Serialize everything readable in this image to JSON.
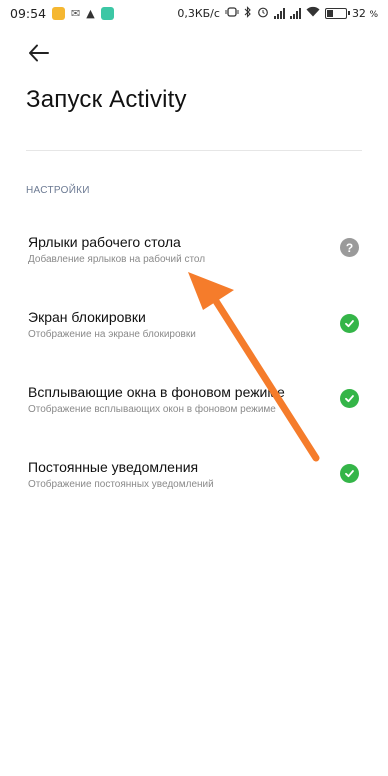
{
  "status_bar": {
    "time": "09:54",
    "network_speed": "0,3КБ/с",
    "battery_percent": "32",
    "battery_unit": "%",
    "battery_level": 0.32,
    "icons": [
      "notification-icon",
      "mail-icon",
      "app-icon",
      "shield-icon",
      "vibrate-icon",
      "bluetooth-icon",
      "alarm-icon",
      "signal-icon",
      "signal-icon",
      "wifi-icon",
      "battery-icon"
    ]
  },
  "header": {
    "back_icon": "arrow-left-icon",
    "title": "Запуск Activity"
  },
  "section": {
    "title": "НАСТРОЙКИ"
  },
  "settings": [
    {
      "title": "Ярлыки рабочего стола",
      "description": "Добавление ярлыков на рабочий стол",
      "status": "unknown",
      "status_symbol": "?"
    },
    {
      "title": "Экран блокировки",
      "description": "Отображение на экране блокировки",
      "status": "granted"
    },
    {
      "title": "Всплывающие окна в фоновом режиме",
      "description": "Отображение всплывающих окон в фоновом режиме",
      "status": "granted"
    },
    {
      "title": "Постоянные уведомления",
      "description": "Отображение постоянных уведомлений",
      "status": "granted"
    }
  ],
  "colors": {
    "accent_green": "#34b548",
    "unknown_gray": "#9a9a9a",
    "annotation_orange": "#f57c2b",
    "section_header": "#6c7a93"
  }
}
